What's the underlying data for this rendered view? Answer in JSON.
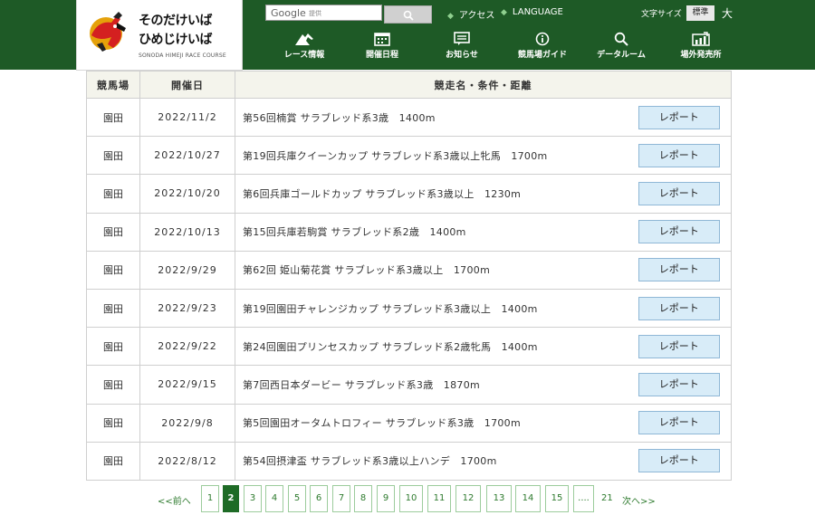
{
  "header": {
    "logo": {
      "line1": "そのだけいば",
      "line2": "ひめじけいば",
      "sub": "SONODA HIMEJI RACE COURSE"
    },
    "search": {
      "brand": "Google",
      "placeholder": "提供"
    },
    "links": [
      {
        "label": "アクセス"
      },
      {
        "label": "LANGUAGE"
      }
    ],
    "font_size": {
      "label": "文字サイズ",
      "standard": "標準",
      "large": "大"
    },
    "nav": [
      {
        "label": "レース情報",
        "icon": "horse-icon"
      },
      {
        "label": "開催日程",
        "icon": "calendar-icon"
      },
      {
        "label": "お知らせ",
        "icon": "news-icon"
      },
      {
        "label": "競馬場ガイド",
        "icon": "info-icon"
      },
      {
        "label": "データルーム",
        "icon": "search-icon"
      },
      {
        "label": "場外発売所",
        "icon": "chart-icon"
      }
    ]
  },
  "table": {
    "headers": [
      "競馬場",
      "開催日",
      "競走名・条件・距離"
    ],
    "button_label": "レポート",
    "rows": [
      {
        "venue": "園田",
        "date": "2022/11/2",
        "race": "第56回楠賞 サラブレッド系3歳　1400m"
      },
      {
        "venue": "園田",
        "date": "2022/10/27",
        "race": "第19回兵庫クイーンカップ サラブレッド系3歳以上牝馬　1700m"
      },
      {
        "venue": "園田",
        "date": "2022/10/20",
        "race": "第6回兵庫ゴールドカップ サラブレッド系3歳以上　1230m"
      },
      {
        "venue": "園田",
        "date": "2022/10/13",
        "race": "第15回兵庫若駒賞 サラブレッド系2歳　1400m"
      },
      {
        "venue": "園田",
        "date": "2022/9/29",
        "race": "第62回 姫山菊花賞 サラブレッド系3歳以上　1700m"
      },
      {
        "venue": "園田",
        "date": "2022/9/23",
        "race": "第19回園田チャレンジカップ サラブレッド系3歳以上　1400m"
      },
      {
        "venue": "園田",
        "date": "2022/9/22",
        "race": "第24回園田プリンセスカップ サラブレッド系2歳牝馬　1400m"
      },
      {
        "venue": "園田",
        "date": "2022/9/15",
        "race": "第7回西日本ダービー サラブレッド系3歳　1870m"
      },
      {
        "venue": "園田",
        "date": "2022/9/8",
        "race": "第5回園田オータムトロフィー サラブレッド系3歳　1700m"
      },
      {
        "venue": "園田",
        "date": "2022/8/12",
        "race": "第54回摂津盃 サラブレッド系3歳以上ハンデ　1700m"
      }
    ]
  },
  "pagination": {
    "prev": "<<前へ",
    "pages": [
      "1",
      "2",
      "3",
      "4",
      "5",
      "6",
      "7",
      "8",
      "9",
      "10",
      "11",
      "12",
      "13",
      "14",
      "15"
    ],
    "current": "2",
    "ellipsis": "....",
    "last": "21",
    "next": "次へ>>"
  },
  "colors": {
    "header_bg": "#1e5a26",
    "button_bg": "#d8ecf8",
    "active_page": "#1e6b26"
  }
}
